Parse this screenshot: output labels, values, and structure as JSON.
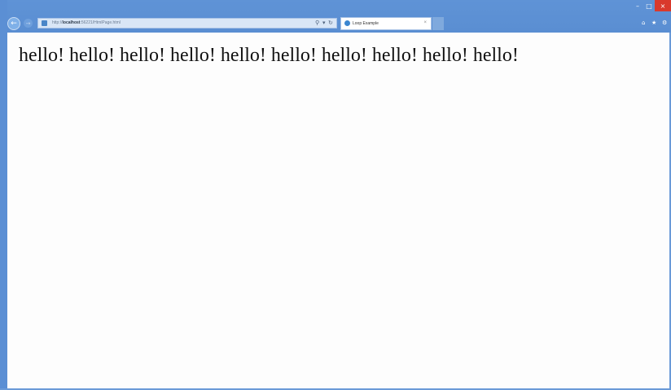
{
  "browser": {
    "address": {
      "prefix": "http://",
      "host": "localhost",
      "rest": ":56221/HtmlPage.html",
      "search_icon": "search-icon",
      "refresh_icon": "refresh-icon"
    },
    "tabs": [
      {
        "label": "Loop Example",
        "active": true
      }
    ],
    "tab_close": "×",
    "window_controls": {
      "minimize": "–",
      "maximize": "□",
      "close": "×"
    },
    "command_icons": [
      "home-icon",
      "star-icon",
      "gear-icon"
    ],
    "frame_color": "#5b8fd4",
    "close_color": "#d9392c"
  },
  "page": {
    "text": "hello! hello! hello! hello! hello! hello! hello! hello! hello! hello!"
  }
}
